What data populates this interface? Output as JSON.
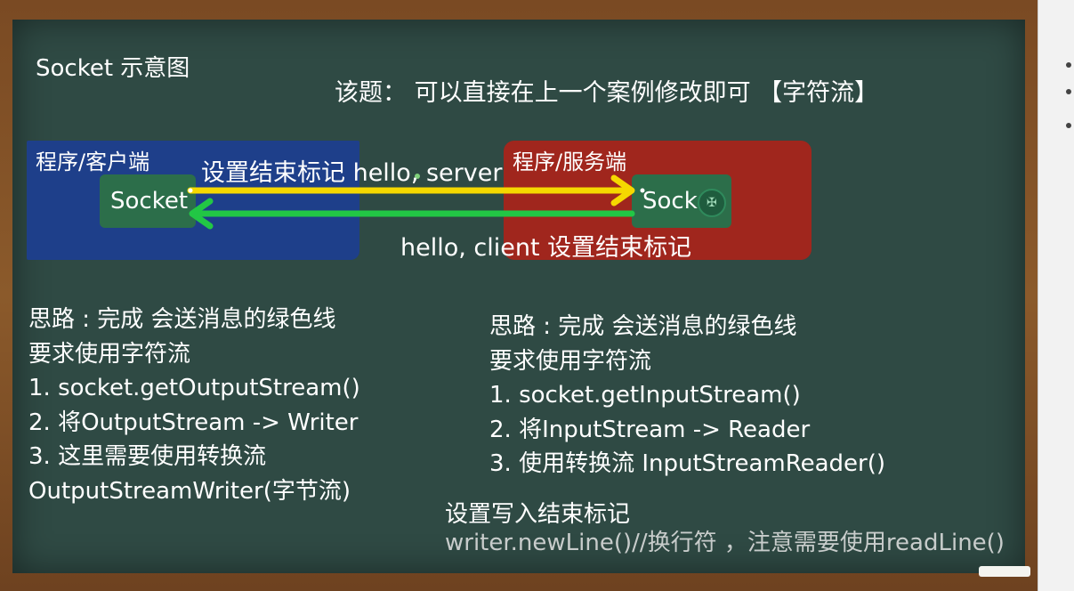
{
  "title": "Socket 示意图",
  "note": "该题： 可以直接在上一个案例修改即可 【字符流】",
  "client": {
    "label": "程序/客户端",
    "socket_label": "Socket",
    "box_color": "#1e3f8a"
  },
  "server": {
    "label": "程序/服务端",
    "socket_label": "Sock",
    "box_color": "#a0261d"
  },
  "messages": {
    "to_server": "设置结束标记 hello, server",
    "to_client": "hello, client 设置结束标记"
  },
  "colors": {
    "board": "#2f4a44",
    "frame": "#8b5a2b",
    "arrow_to_server": "#f5d800",
    "arrow_to_client": "#22c745"
  },
  "left_block": {
    "lines": [
      "思路 : 完成 会送消息的绿色线",
      "要求使用字符流",
      "1. socket.getOutputStream()",
      "2. 将OutputStream -> Writer",
      "3. 这里需要使用转换流",
      "OutputStreamWriter(字节流)"
    ]
  },
  "right_block": {
    "lines": [
      "思路 : 完成 会送消息的绿色线",
      "要求使用字符流",
      "1. socket.getInputStream()",
      "2. 将InputStream -> Reader",
      "3. 使用转换流 InputStreamReader()"
    ]
  },
  "bottom_note": {
    "line1": "设置写入结束标记",
    "line2": "writer.newLine()//换行符  ，注意需要使用readLine()"
  },
  "icons": {
    "server_socket_overlay": "crosshair-icon"
  }
}
